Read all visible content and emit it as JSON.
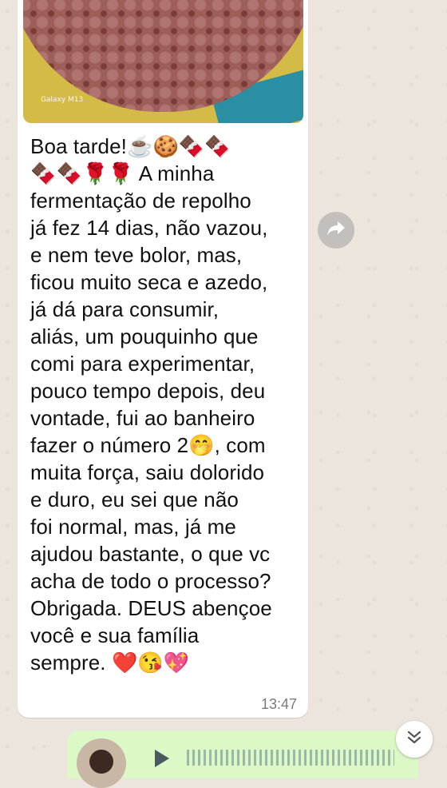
{
  "photo": {
    "watermark": "Galaxy M13"
  },
  "message": {
    "lines": [
      "Boa tarde!☕🍪🍫🍫",
      "🍫🍫🌹🌹 A minha",
      "fermentação de repolho",
      "já fez 14 dias, não vazou,",
      "e nem teve bolor, mas,",
      "ficou muito seca e azedo,",
      "já dá para consumir,",
      "aliás, um pouquinho que",
      "comi para experimentar,",
      "pouco tempo depois, deu",
      "vontade, fui ao banheiro",
      "fazer o número 2🤭, com",
      "muita força, saiu dolorido",
      "e duro, eu sei que não",
      "foi normal, mas, já me",
      "ajudou bastante, o que vc",
      "acha de todo o processo?",
      "Obrigada. DEUS abençoe",
      "você e sua família",
      "sempre. ❤️😘💖"
    ],
    "time": "13:47"
  },
  "icons": {
    "forward": "forward-arrow-icon",
    "scroll_down": "double-chevron-down-icon",
    "play": "play-icon"
  },
  "colors": {
    "chat_background": "#ece5dd",
    "incoming_bubble": "#ffffff",
    "outgoing_bubble": "#dcf8c6",
    "timestamp": "#7a7a7a"
  }
}
